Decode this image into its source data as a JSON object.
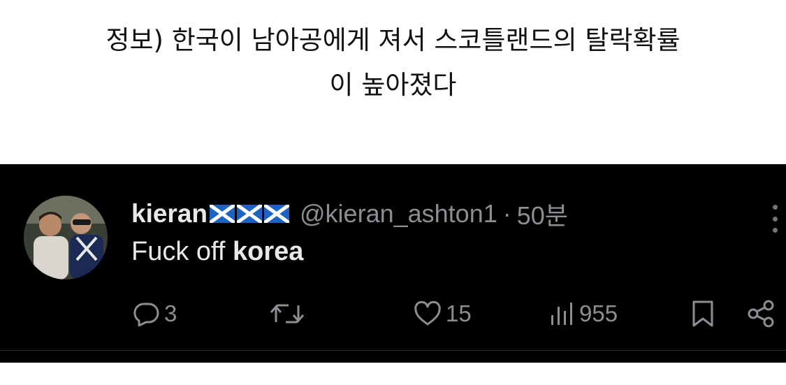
{
  "headline": {
    "line1": "정보) 한국이 남아공에게 져서 스코틀랜드의 탈락확률",
    "line2": "이 높아졌다"
  },
  "tweet": {
    "display_name": "kieran",
    "flags": [
      "scotland-flag-icon",
      "scotland-flag-icon",
      "scotland-flag-icon"
    ],
    "handle": "@kieran_ashton1",
    "separator": "·",
    "time": "50분",
    "text_plain": "Fuck off ",
    "text_bold": "korea",
    "actions": {
      "replies": "3",
      "retweets": "",
      "likes": "15",
      "views": "955"
    }
  },
  "colors": {
    "tweet_bg": "#000000",
    "primary_text": "#e7e9ea",
    "secondary_text": "#8b8f94",
    "flag_blue": "#1d63c4"
  }
}
